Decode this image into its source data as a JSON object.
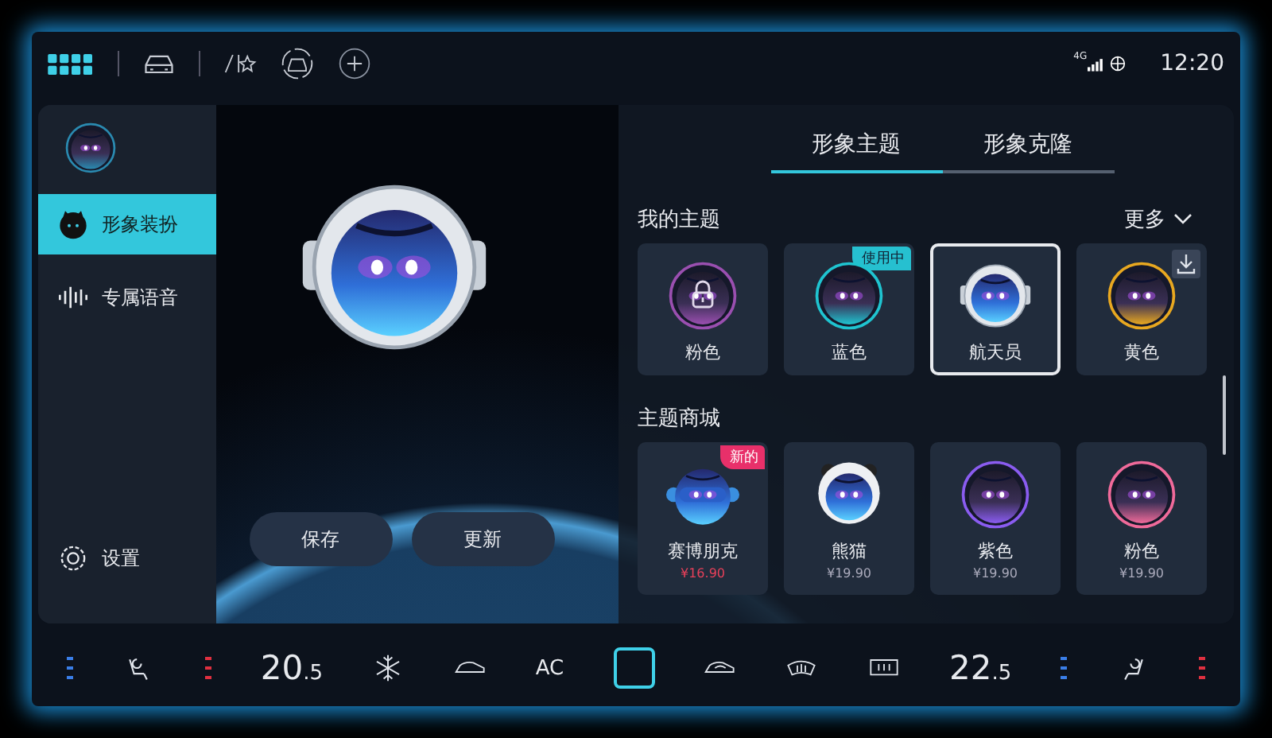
{
  "status_bar": {
    "network": "4G",
    "time": "12:20"
  },
  "sidebar": {
    "items": [
      {
        "label": "形象装扮",
        "kind": "avatar",
        "selected": true
      },
      {
        "label": "专属语音",
        "kind": "voice",
        "selected": false
      }
    ],
    "settings": "设置"
  },
  "preview": {
    "buttons": [
      "保存",
      "更新"
    ]
  },
  "tabs": [
    {
      "label": "形象主题",
      "selected": true
    },
    {
      "label": "形象克隆",
      "selected": false
    }
  ],
  "my_themes": {
    "title": "我的主题",
    "more": "更多",
    "items": [
      {
        "name": "粉色",
        "kind": "ring",
        "color": "#9a4fb0",
        "locked": true,
        "downloadable": false,
        "selected": false
      },
      {
        "name": "蓝色",
        "kind": "ring",
        "color": "#1fc4d0",
        "badge": "使用中",
        "locked": false,
        "downloadable": false,
        "selected": false
      },
      {
        "name": "航天员",
        "kind": "helmet",
        "locked": false,
        "downloadable": false,
        "selected": true
      },
      {
        "name": "黄色",
        "kind": "ring",
        "color": "#e8a820",
        "locked": false,
        "downloadable": true,
        "selected": false
      }
    ]
  },
  "store": {
    "title": "主题商城",
    "items": [
      {
        "name": "赛博朋克",
        "kind": "cyber",
        "price": "¥16.90",
        "badge": "新的",
        "discounted": true
      },
      {
        "name": "熊猫",
        "kind": "panda",
        "price": "¥19.90",
        "discounted": false
      },
      {
        "name": "紫色",
        "kind": "ring",
        "color": "#8a5cf0",
        "price": "¥19.90",
        "discounted": false
      },
      {
        "name": "粉色",
        "kind": "ring",
        "color": "#f06a9a",
        "price": "¥19.90",
        "discounted": false
      }
    ]
  },
  "climate": {
    "left_temp": {
      "whole": "20",
      "fraction": ".5"
    },
    "ac": "AC",
    "right_temp": {
      "whole": "22",
      "fraction": ".5"
    }
  }
}
